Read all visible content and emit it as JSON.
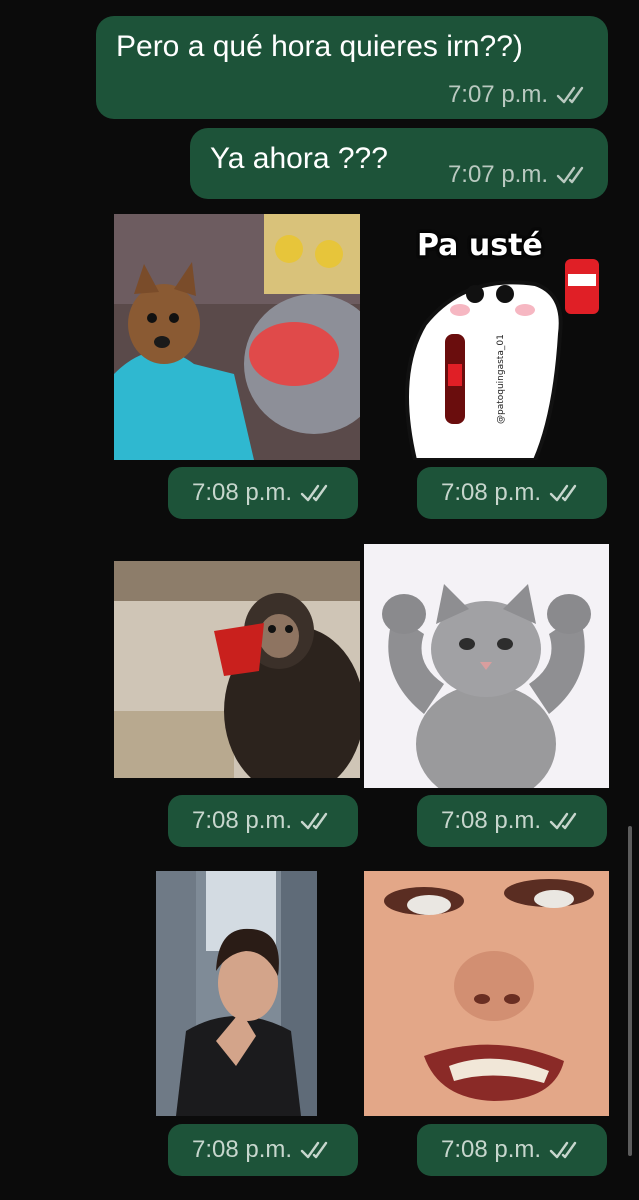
{
  "colors": {
    "background": "#0b0b0b",
    "bubble": "#1d5339",
    "text": "#ffffff",
    "meta": "#b9c9c0"
  },
  "messages": [
    {
      "text": "Pero a qué hora quieres irn??)",
      "time": "7:07 p.m.",
      "status": "read-double-check-icon"
    },
    {
      "text": "Ya ahora ???",
      "time": "7:07 p.m.",
      "status": "read-double-check-icon"
    }
  ],
  "media": [
    {
      "kind": "gif",
      "subject": "dog wrapped in blue towel",
      "time": "7:08 p.m."
    },
    {
      "kind": "sticker",
      "subject": "flork meme holding soda bottle",
      "caption": "Pa usté",
      "watermark": "@patoquingasta_01",
      "time": "7:08 p.m."
    },
    {
      "kind": "gif",
      "subject": "monkey drinking from red cup",
      "time": "7:08 p.m."
    },
    {
      "kind": "sticker",
      "subject": "cat flexing arms",
      "time": "7:08 p.m."
    },
    {
      "kind": "gif",
      "subject": "man clapping hands",
      "time": "7:08 p.m."
    },
    {
      "kind": "sticker",
      "subject": "close-up grimacing face",
      "time": "7:08 p.m."
    }
  ]
}
